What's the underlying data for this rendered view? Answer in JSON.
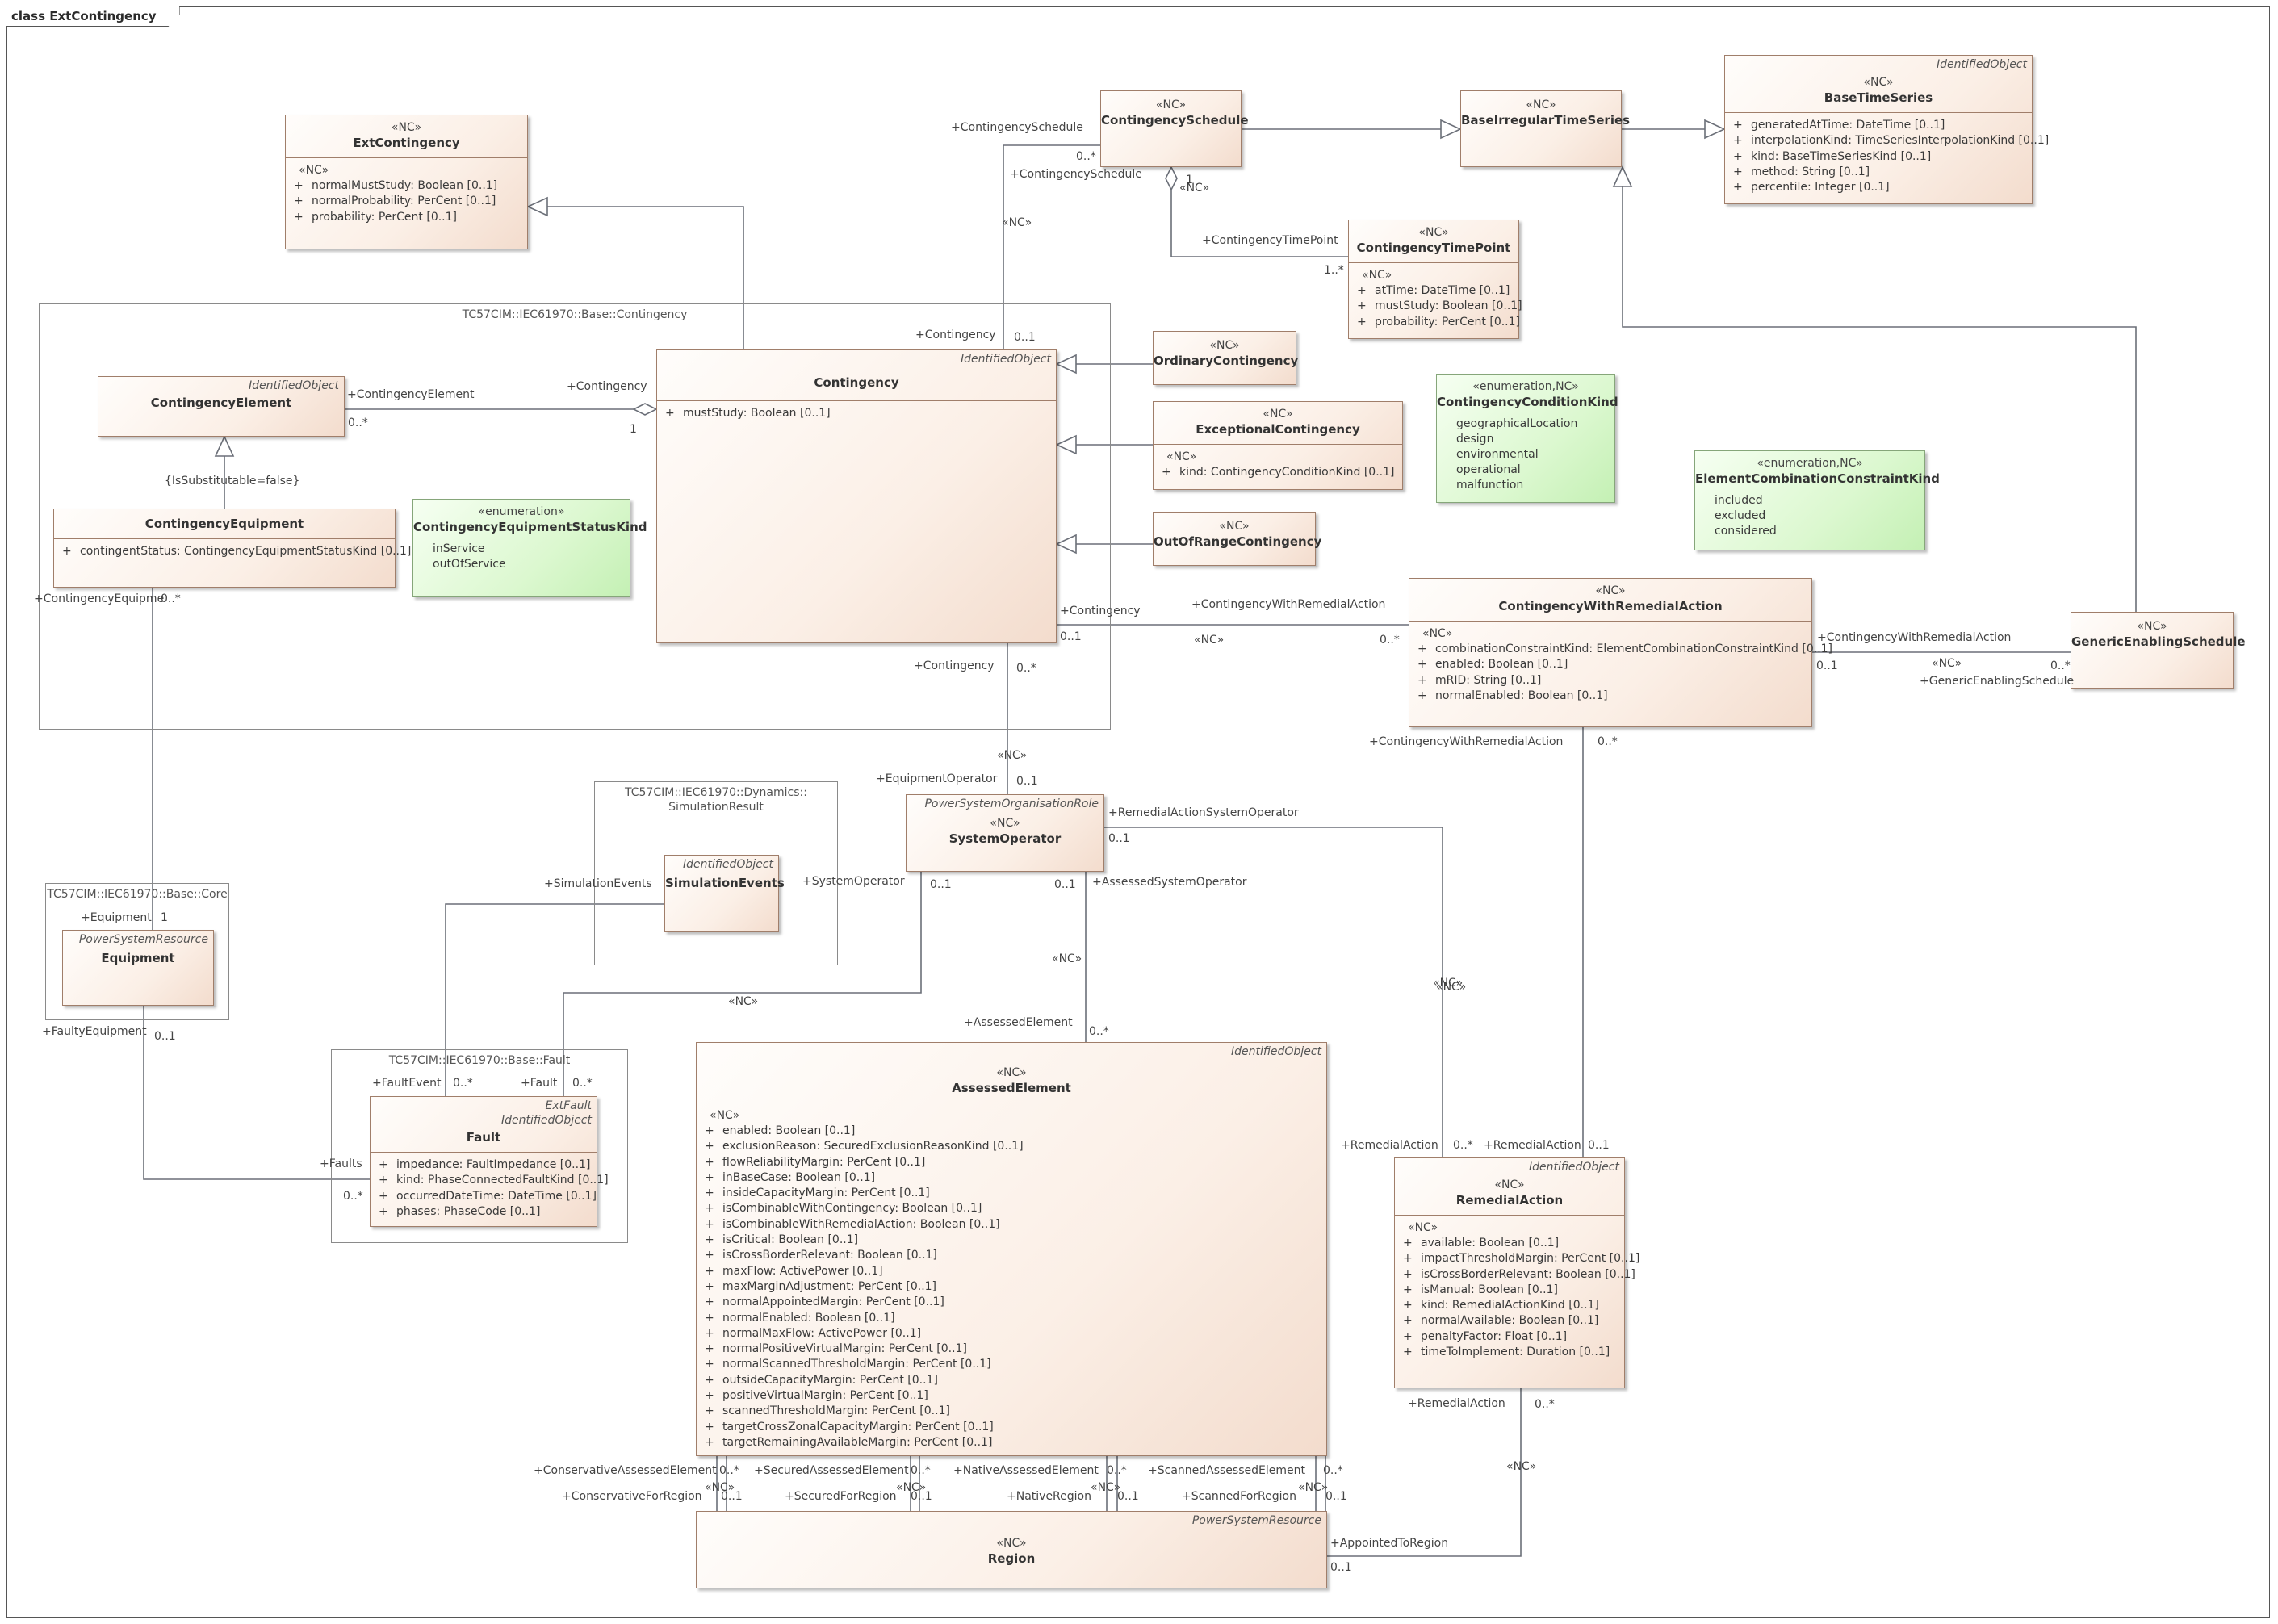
{
  "diagram": {
    "title": "class ExtContingency"
  },
  "packages": {
    "contingency": "TC57CIM::IEC61970::Base::Contingency",
    "simulation": "TC57CIM::IEC61970::Dynamics::\nSimulationResult",
    "core": "TC57CIM::IEC61970::Base::Core",
    "fault": "TC57CIM::IEC61970::Base::Fault"
  },
  "classes": {
    "ext_contingency": {
      "stereotype": "«NC»",
      "name": "ExtContingency",
      "attr_stereotype": "«NC»",
      "attributes": [
        "normalMustStudy: Boolean [0..1]",
        "normalProbability: PerCent [0..1]",
        "probability: PerCent [0..1]"
      ]
    },
    "contingency_schedule": {
      "stereotype": "«NC»",
      "name": "ContingencySchedule"
    },
    "base_irregular_time_series": {
      "stereotype": "«NC»",
      "name": "BaseIrregularTimeSeries"
    },
    "base_time_series": {
      "parent": "IdentifiedObject",
      "stereotype": "«NC»",
      "name": "BaseTimeSeries",
      "attributes": [
        "generatedAtTime: DateTime [0..1]",
        "interpolationKind: TimeSeriesInterpolationKind [0..1]",
        "kind: BaseTimeSeriesKind [0..1]",
        "method: String [0..1]",
        "percentile: Integer [0..1]"
      ]
    },
    "contingency_time_point": {
      "stereotype": "«NC»",
      "name": "ContingencyTimePoint",
      "attr_stereotype": "«NC»",
      "attributes": [
        "atTime: DateTime [0..1]",
        "mustStudy: Boolean [0..1]",
        "probability: PerCent [0..1]"
      ]
    },
    "contingency_element": {
      "parent": "IdentifiedObject",
      "name": "ContingencyElement"
    },
    "contingency": {
      "parent": "IdentifiedObject",
      "name": "Contingency",
      "attributes": [
        "mustStudy: Boolean [0..1]"
      ]
    },
    "ordinary_contingency": {
      "stereotype": "«NC»",
      "name": "OrdinaryContingency"
    },
    "exceptional_contingency": {
      "stereotype": "«NC»",
      "name": "ExceptionalContingency",
      "attr_stereotype": "«NC»",
      "attributes": [
        "kind: ContingencyConditionKind [0..1]"
      ]
    },
    "out_of_range_contingency": {
      "stereotype": "«NC»",
      "name": "OutOfRangeContingency"
    },
    "contingency_equipment": {
      "name": "ContingencyEquipment",
      "attributes": [
        "contingentStatus: ContingencyEquipmentStatusKind [0..1]"
      ]
    },
    "contingency_equipment_status_kind": {
      "stereotype": "«enumeration»",
      "name": "ContingencyEquipmentStatusKind",
      "literals": [
        "inService",
        "outOfService"
      ]
    },
    "contingency_condition_kind": {
      "stereotype": "«enumeration,NC»",
      "name": "ContingencyConditionKind",
      "literals": [
        "geographicalLocation",
        "design",
        "environmental",
        "operational",
        "malfunction"
      ]
    },
    "element_combination_constraint_kind": {
      "stereotype": "«enumeration,NC»",
      "name": "ElementCombinationConstraintKind",
      "literals": [
        "included",
        "excluded",
        "considered"
      ]
    },
    "contingency_with_remedial_action": {
      "stereotype": "«NC»",
      "name": "ContingencyWithRemedialAction",
      "attr_stereotype": "«NC»",
      "attributes": [
        "combinationConstraintKind: ElementCombinationConstraintKind [0..1]",
        "enabled: Boolean [0..1]",
        "mRID: String [0..1]",
        "normalEnabled: Boolean [0..1]"
      ]
    },
    "generic_enabling_schedule": {
      "stereotype": "«NC»",
      "name": "GenericEnablingSchedule"
    },
    "simulation_events": {
      "parent": "IdentifiedObject",
      "name": "SimulationEvents"
    },
    "system_operator": {
      "parent": "PowerSystemOrganisationRole",
      "stereotype": "«NC»",
      "name": "SystemOperator"
    },
    "equipment": {
      "parent": "PowerSystemResource",
      "name": "Equipment"
    },
    "fault": {
      "parent": "ExtFault\nIdentifiedObject",
      "name": "Fault",
      "attributes": [
        "impedance: FaultImpedance [0..1]",
        "kind: PhaseConnectedFaultKind [0..1]",
        "occurredDateTime: DateTime [0..1]",
        "phases: PhaseCode [0..1]"
      ]
    },
    "assessed_element": {
      "parent": "IdentifiedObject",
      "stereotype": "«NC»",
      "name": "AssessedElement",
      "attr_stereotype": "«NC»",
      "attributes": [
        "enabled: Boolean [0..1]",
        "exclusionReason: SecuredExclusionReasonKind [0..1]",
        "flowReliabilityMargin: PerCent [0..1]",
        "inBaseCase: Boolean [0..1]",
        "insideCapacityMargin: PerCent [0..1]",
        "isCombinableWithContingency: Boolean [0..1]",
        "isCombinableWithRemedialAction: Boolean [0..1]",
        "isCritical: Boolean [0..1]",
        "isCrossBorderRelevant: Boolean [0..1]",
        "maxFlow: ActivePower [0..1]",
        "maxMarginAdjustment: PerCent [0..1]",
        "normalAppointedMargin: PerCent [0..1]",
        "normalEnabled: Boolean [0..1]",
        "normalMaxFlow: ActivePower [0..1]",
        "normalPositiveVirtualMargin: PerCent [0..1]",
        "normalScannedThresholdMargin: PerCent [0..1]",
        "outsideCapacityMargin: PerCent [0..1]",
        "positiveVirtualMargin: PerCent [0..1]",
        "scannedThresholdMargin: PerCent [0..1]",
        "targetCrossZonalCapacityMargin: PerCent [0..1]",
        "targetRemainingAvailableMargin: PerCent [0..1]"
      ]
    },
    "remedial_action": {
      "parent": "IdentifiedObject",
      "stereotype": "«NC»",
      "name": "RemedialAction",
      "attr_stereotype": "«NC»",
      "attributes": [
        "available: Boolean [0..1]",
        "impactThresholdMargin: PerCent [0..1]",
        "isCrossBorderRelevant: Boolean [0..1]",
        "isManual: Boolean [0..1]",
        "kind: RemedialActionKind [0..1]",
        "normalAvailable: Boolean [0..1]",
        "penaltyFactor: Float [0..1]",
        "timeToImplement: Duration [0..1]"
      ]
    },
    "region": {
      "parent": "PowerSystemResource",
      "stereotype": "«NC»",
      "name": "Region"
    }
  },
  "labels": [
    "+ContingencySchedule",
    "0..*",
    "+ContingencySchedule",
    "1",
    "«NC»",
    "«NC»",
    "+ContingencyTimePoint",
    "1..*",
    "+Contingency",
    "0..1",
    "+ContingencyElement",
    "+Contingency",
    "0..*",
    "1",
    "{IsSubstitutable=false}",
    "+ContingencyEquipme",
    "0..*",
    "+Contingency",
    "+ContingencyWithRemedialAction",
    "0..1",
    "«NC»",
    "0..*",
    "+Contingency",
    "0..*",
    "«NC»",
    "+EquipmentOperator",
    "0..1",
    "+RemedialActionSystemOperator",
    "0..1",
    "+AssessedSystemOperator",
    "+SimulationEvents",
    "+SystemOperator",
    "0..1",
    "0..1",
    "+Equipment",
    "1",
    "+FaultyEquipment",
    "0..1",
    "«NC»",
    "«NC»",
    "+AssessedElement",
    "0..*",
    "+FaultEvent",
    "0..*",
    "+Fault",
    "0..*",
    "+Faults",
    "0..*",
    "+ContingencyWithRemedialAction",
    "0..*",
    "«NC»",
    "«NC»",
    "+ContingencyWithRemedialAction",
    "0..1",
    "«NC»",
    "0..*",
    "+GenericEnablingSchedule",
    "+RemedialAction",
    "0..*",
    "+RemedialAction",
    "0..1",
    "+RemedialAction",
    "0..*",
    "«NC»",
    "+ConservativeAssessedElement",
    "0..*",
    "+ConservativeForRegion",
    "«NC»",
    "0..1",
    "+SecuredAssessedElement",
    "0..*",
    "+SecuredForRegion",
    "«NC»",
    "0..1",
    "+NativeAssessedElement",
    "0..*",
    "+NativeRegion",
    "«NC»",
    "0..1",
    "+ScannedAssessedElement",
    "0..*",
    "+ScannedForRegion",
    "«NC»",
    "0..1",
    "+AppointedToRegion",
    "0..1"
  ]
}
